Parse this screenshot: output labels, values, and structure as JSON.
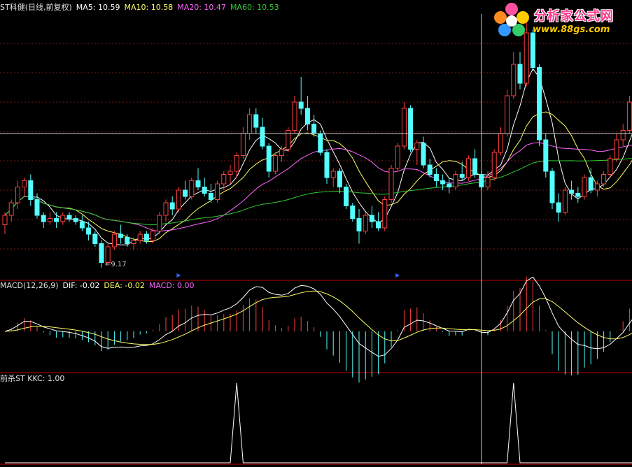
{
  "header_main": {
    "title": "ST科健(日线,前复权)",
    "ma5": "MA5: 10.59",
    "ma10": "MA10: 10.58",
    "ma20": "MA20: 10.47",
    "ma60": "MA60: 10.53"
  },
  "header_macd": {
    "title": "MACD(12,26,9)",
    "dif": "DIF: -0.02",
    "dea": "DEA: -0.02",
    "macd": "MACD: 0.00"
  },
  "header_kkc": {
    "title": "前杀ST KKC: 1.00"
  },
  "logo": {
    "title": "分析家公式网",
    "url": "www.88gs.com"
  },
  "low_label": "9.17",
  "colors": {
    "background": "#000000",
    "up": "#ff4040",
    "down": "#54ffff",
    "ma5": "#ffffff",
    "ma10": "#ffff66",
    "ma20": "#ff66ff",
    "ma60": "#33cc33",
    "grid": "#7a1a1a",
    "border": "#c00000",
    "title_text": "#e0e0e0"
  },
  "chart_data": [
    {
      "type": "candlestick",
      "name": "ST科健(日线,前复权)",
      "period": "daily",
      "y_range": [
        9.0,
        13.2
      ],
      "candles": [
        [
          9.85,
          10.05,
          9.7,
          10.0
        ],
        [
          10.0,
          10.25,
          9.9,
          10.2
        ],
        [
          10.2,
          10.55,
          10.1,
          10.45
        ],
        [
          10.45,
          10.6,
          10.3,
          10.55
        ],
        [
          10.55,
          10.65,
          10.15,
          10.25
        ],
        [
          10.25,
          10.35,
          9.95,
          10.0
        ],
        [
          10.0,
          10.05,
          9.8,
          9.9
        ],
        [
          9.9,
          10.05,
          9.85,
          9.95
        ],
        [
          9.95,
          10.05,
          9.8,
          9.9
        ],
        [
          9.9,
          10.05,
          9.85,
          10.0
        ],
        [
          10.0,
          10.05,
          9.9,
          9.95
        ],
        [
          9.95,
          10.0,
          9.85,
          9.9
        ],
        [
          9.9,
          10.0,
          9.75,
          9.8
        ],
        [
          9.8,
          9.9,
          9.6,
          9.7
        ],
        [
          9.7,
          9.75,
          9.5,
          9.55
        ],
        [
          9.55,
          9.6,
          9.17,
          9.25
        ],
        [
          9.25,
          9.55,
          9.2,
          9.5
        ],
        [
          9.5,
          9.75,
          9.45,
          9.7
        ],
        [
          9.7,
          9.85,
          9.55,
          9.65
        ],
        [
          9.65,
          9.7,
          9.5,
          9.55
        ],
        [
          9.55,
          9.65,
          9.45,
          9.6
        ],
        [
          9.6,
          9.75,
          9.55,
          9.7
        ],
        [
          9.7,
          9.75,
          9.55,
          9.6
        ],
        [
          9.6,
          9.8,
          9.55,
          9.75
        ],
        [
          9.75,
          10.05,
          9.7,
          10.0
        ],
        [
          10.0,
          10.25,
          9.9,
          10.2
        ],
        [
          10.2,
          10.3,
          10.0,
          10.1
        ],
        [
          10.1,
          10.45,
          10.05,
          10.4
        ],
        [
          10.4,
          10.55,
          10.25,
          10.3
        ],
        [
          10.3,
          10.6,
          10.25,
          10.55
        ],
        [
          10.55,
          10.75,
          10.4,
          10.45
        ],
        [
          10.45,
          10.6,
          10.3,
          10.35
        ],
        [
          10.35,
          10.5,
          10.2,
          10.25
        ],
        [
          10.25,
          10.55,
          10.2,
          10.5
        ],
        [
          10.5,
          10.7,
          10.4,
          10.65
        ],
        [
          10.65,
          10.8,
          10.5,
          10.7
        ],
        [
          10.7,
          11.0,
          10.6,
          10.95
        ],
        [
          10.95,
          11.4,
          10.9,
          11.3
        ],
        [
          11.3,
          11.7,
          11.2,
          11.6
        ],
        [
          11.6,
          11.7,
          11.3,
          11.4
        ],
        [
          11.4,
          11.55,
          11.05,
          11.1
        ],
        [
          11.1,
          11.15,
          10.6,
          10.7
        ],
        [
          10.7,
          11.0,
          10.65,
          10.95
        ],
        [
          10.95,
          11.1,
          10.85,
          11.05
        ],
        [
          11.05,
          11.4,
          11.0,
          11.35
        ],
        [
          11.35,
          11.9,
          11.3,
          11.8
        ],
        [
          11.8,
          12.2,
          11.6,
          11.7
        ],
        [
          11.7,
          11.9,
          11.35,
          11.45
        ],
        [
          11.45,
          11.6,
          11.25,
          11.3
        ],
        [
          11.3,
          11.35,
          10.95,
          11.0
        ],
        [
          11.0,
          11.05,
          10.5,
          10.6
        ],
        [
          10.6,
          10.75,
          10.45,
          10.7
        ],
        [
          10.7,
          10.75,
          10.35,
          10.45
        ],
        [
          10.45,
          10.5,
          10.1,
          10.15
        ],
        [
          10.15,
          10.2,
          9.9,
          9.95
        ],
        [
          9.95,
          10.1,
          9.55,
          9.75
        ],
        [
          9.75,
          10.05,
          9.7,
          10.0
        ],
        [
          10.0,
          10.15,
          9.8,
          9.9
        ],
        [
          9.9,
          10.05,
          9.75,
          9.8
        ],
        [
          9.8,
          10.3,
          9.75,
          10.25
        ],
        [
          10.25,
          10.8,
          10.2,
          10.75
        ],
        [
          10.75,
          11.15,
          10.7,
          11.1
        ],
        [
          11.1,
          11.8,
          11.05,
          11.7
        ],
        [
          11.7,
          11.75,
          11.0,
          11.05
        ],
        [
          11.05,
          11.2,
          10.8,
          11.15
        ],
        [
          11.15,
          11.25,
          10.75,
          10.8
        ],
        [
          10.8,
          10.9,
          10.6,
          10.65
        ],
        [
          10.65,
          10.75,
          10.45,
          10.55
        ],
        [
          10.55,
          10.65,
          10.4,
          10.5
        ],
        [
          10.5,
          10.6,
          10.35,
          10.45
        ],
        [
          10.45,
          10.7,
          10.4,
          10.65
        ],
        [
          10.65,
          10.85,
          10.55,
          10.6
        ],
        [
          10.6,
          10.95,
          10.55,
          10.9
        ],
        [
          10.9,
          11.05,
          10.6,
          10.65
        ],
        [
          10.65,
          10.7,
          10.4,
          10.45
        ],
        [
          10.45,
          10.7,
          10.4,
          10.6
        ],
        [
          10.6,
          11.05,
          10.55,
          11.0
        ],
        [
          11.0,
          11.4,
          10.95,
          11.3
        ],
        [
          11.3,
          12.0,
          11.25,
          11.9
        ],
        [
          11.9,
          12.6,
          11.85,
          12.4
        ],
        [
          12.4,
          12.6,
          12.0,
          12.1
        ],
        [
          12.1,
          13.1,
          12.05,
          12.9
        ],
        [
          12.9,
          12.95,
          12.3,
          12.35
        ],
        [
          12.35,
          12.4,
          11.1,
          11.2
        ],
        [
          11.2,
          11.3,
          10.6,
          10.7
        ],
        [
          10.7,
          10.75,
          10.1,
          10.2
        ],
        [
          10.2,
          10.35,
          9.9,
          10.05
        ],
        [
          10.05,
          10.45,
          10.0,
          10.4
        ],
        [
          10.4,
          10.55,
          10.25,
          10.35
        ],
        [
          10.35,
          10.45,
          10.2,
          10.3
        ],
        [
          10.3,
          10.65,
          10.25,
          10.6
        ],
        [
          10.6,
          10.75,
          10.35,
          10.4
        ],
        [
          10.4,
          10.55,
          10.3,
          10.5
        ],
        [
          10.5,
          10.7,
          10.45,
          10.65
        ],
        [
          10.65,
          10.95,
          10.6,
          10.9
        ],
        [
          10.9,
          11.3,
          10.85,
          11.2
        ],
        [
          11.2,
          11.45,
          11.1,
          11.35
        ],
        [
          11.35,
          11.9,
          11.3,
          11.8
        ],
        [
          11.8,
          12.0,
          11.6,
          11.95
        ]
      ],
      "ma_periods": [
        5,
        10,
        20,
        60
      ],
      "low_marker": 9.17
    },
    {
      "type": "bar",
      "name": "MACD(12,26,9)",
      "y_range": [
        -0.32,
        0.32
      ],
      "series_names": [
        "DIF",
        "DEA",
        "MACD"
      ],
      "last_values": {
        "DIF": -0.02,
        "DEA": -0.02,
        "MACD": 0.0
      }
    },
    {
      "type": "line",
      "name": "前杀ST",
      "series_names": [
        "KKC"
      ],
      "y_range": [
        0,
        1
      ],
      "spike_indexes": [
        36,
        79
      ],
      "last_values": {
        "KKC": 1.0
      }
    }
  ]
}
